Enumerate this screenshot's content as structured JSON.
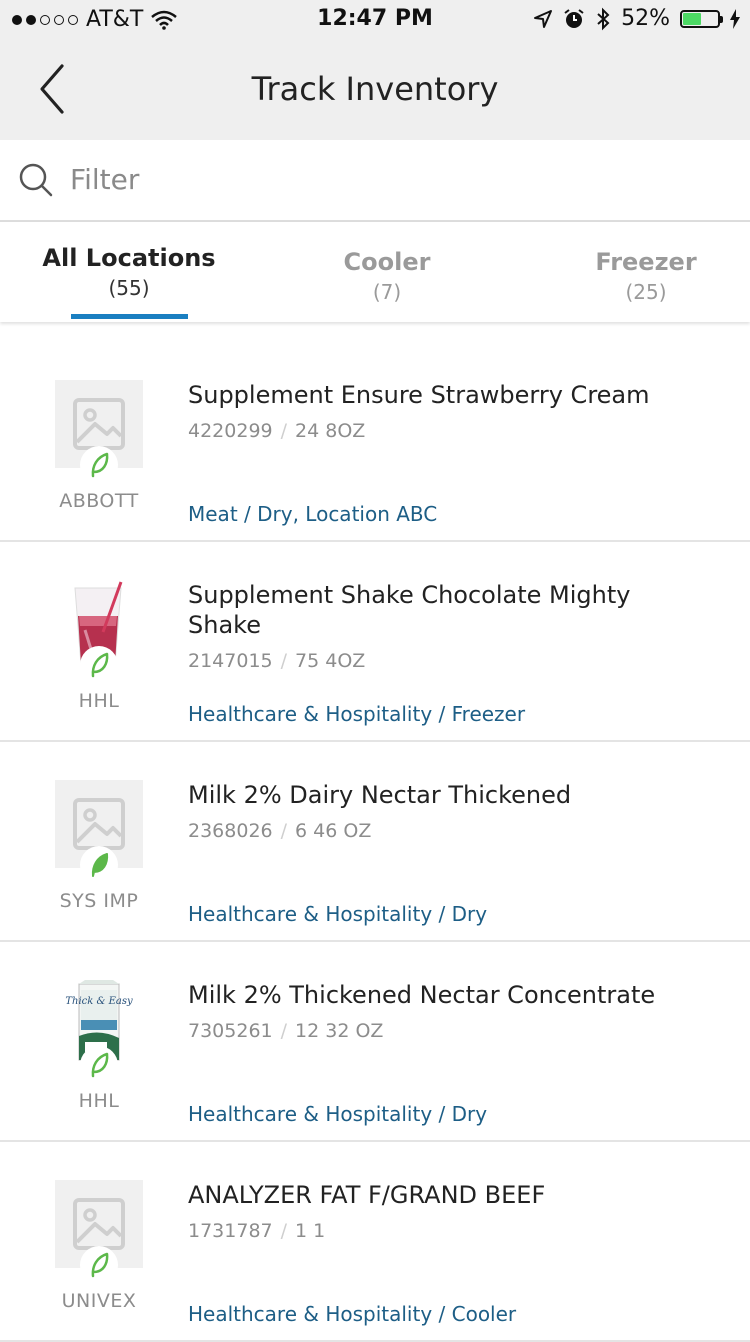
{
  "status_bar": {
    "carrier": "AT&T",
    "time": "12:47 PM",
    "battery": "52%",
    "battery_level": 0.52,
    "signal_bars_filled": 2,
    "signal_bars_total": 5
  },
  "nav": {
    "title": "Track Inventory"
  },
  "filter": {
    "placeholder": "Filter"
  },
  "tabs": [
    {
      "label": "All Locations",
      "count": "(55)",
      "active": true
    },
    {
      "label": "Cooler",
      "count": "(7)",
      "active": false
    },
    {
      "label": "Freezer",
      "count": "(25)",
      "active": false
    }
  ],
  "colors": {
    "accent": "#1a7fc1",
    "location_link": "#1d5e86",
    "leaf": "#5cb84a",
    "battery": "#4cd964"
  },
  "items": [
    {
      "name": "Supplement Ensure Strawberry Cream",
      "code": "4220299",
      "size": "24 8OZ",
      "brand": "ABBOTT",
      "location": "Meat / Dry, Location ABC",
      "image": "placeholder-image-icon"
    },
    {
      "name": "Supplement Shake Chocolate Mighty Shake",
      "code": "2147015",
      "size": "75 4OZ",
      "brand": "HHL",
      "location": "Healthcare & Hospitality / Freezer",
      "image": "shake-glass-photo"
    },
    {
      "name": "Milk 2% Dairy Nectar Thickened",
      "code": "2368026",
      "size": "6 46 OZ",
      "brand": "SYS IMP",
      "location": "Healthcare & Hospitality / Dry",
      "image": "placeholder-image-icon"
    },
    {
      "name": "Milk 2% Thickened Nectar Concentrate",
      "code": "7305261",
      "size": "12 32 OZ",
      "brand": "HHL",
      "location": "Healthcare & Hospitality / Dry",
      "image": "thick-easy-carton-photo",
      "carton_text": "Thick & Easy"
    },
    {
      "name": "ANALYZER FAT F/GRAND BEEF",
      "code": "1731787",
      "size": "1 1",
      "brand": "UNIVEX",
      "location": "Healthcare & Hospitality / Cooler",
      "image": "placeholder-image-icon"
    }
  ]
}
